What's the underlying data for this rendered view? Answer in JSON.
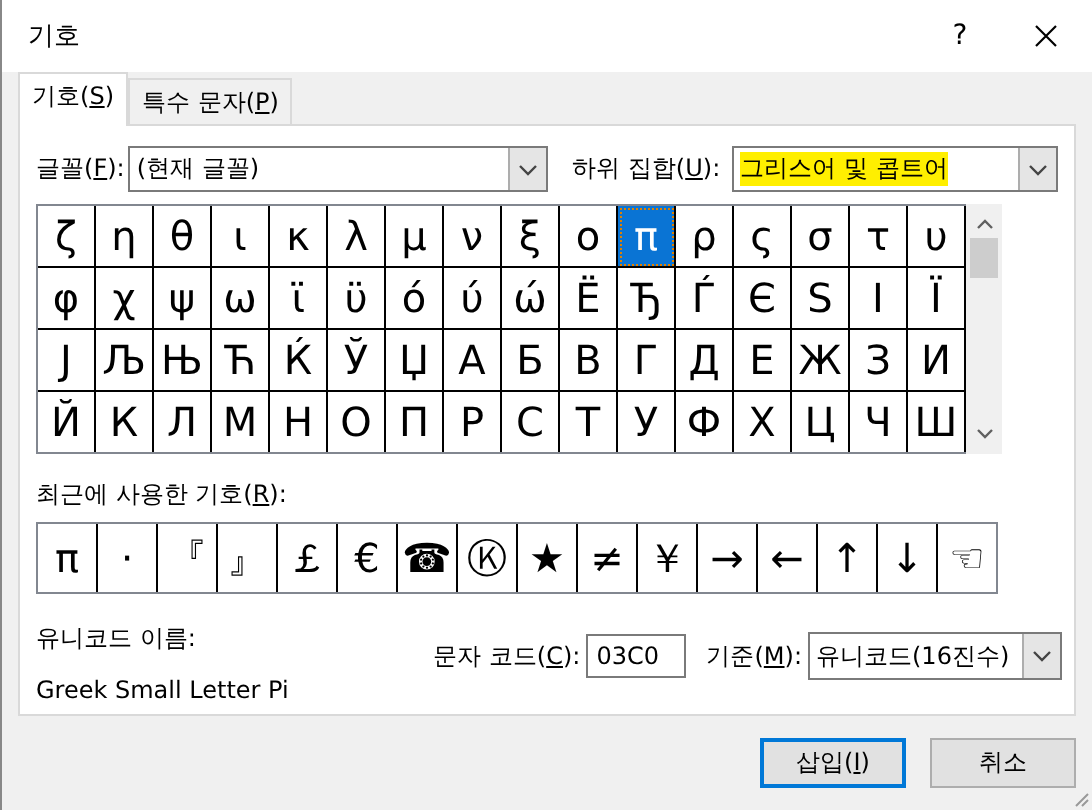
{
  "window": {
    "title": "기호",
    "help": "?"
  },
  "tabs": [
    {
      "label": {
        "pre": "기호(",
        "key": "S",
        "post": ")"
      },
      "selected": true
    },
    {
      "label": {
        "pre": "특수 문자(",
        "key": "P",
        "post": ")"
      },
      "selected": false
    }
  ],
  "font": {
    "label": {
      "pre": "글꼴(",
      "key": "F",
      "post": "):"
    },
    "value": "(현재 글꼴)"
  },
  "subset": {
    "label": {
      "pre": "하위 집합(",
      "key": "U",
      "post": "):"
    },
    "value": "그리스어 및 콥트어",
    "highlighted": true
  },
  "symbol_grid": [
    [
      {
        "char": "ζ",
        "selected": false
      },
      {
        "char": "η",
        "selected": false
      },
      {
        "char": "θ",
        "selected": false
      },
      {
        "char": "ι",
        "selected": false
      },
      {
        "char": "κ",
        "selected": false
      },
      {
        "char": "λ",
        "selected": false
      },
      {
        "char": "μ",
        "selected": false
      },
      {
        "char": "ν",
        "selected": false
      },
      {
        "char": "ξ",
        "selected": false
      },
      {
        "char": "ο",
        "selected": false
      },
      {
        "char": "π",
        "selected": true
      },
      {
        "char": "ρ",
        "selected": false
      },
      {
        "char": "ς",
        "selected": false
      },
      {
        "char": "σ",
        "selected": false
      },
      {
        "char": "τ",
        "selected": false
      },
      {
        "char": "υ",
        "selected": false
      }
    ],
    [
      {
        "char": "φ",
        "selected": false
      },
      {
        "char": "χ",
        "selected": false
      },
      {
        "char": "ψ",
        "selected": false
      },
      {
        "char": "ω",
        "selected": false
      },
      {
        "char": "ϊ",
        "selected": false
      },
      {
        "char": "ϋ",
        "selected": false
      },
      {
        "char": "ό",
        "selected": false
      },
      {
        "char": "ύ",
        "selected": false
      },
      {
        "char": "ώ",
        "selected": false
      },
      {
        "char": "Ё",
        "selected": false
      },
      {
        "char": "Ђ",
        "selected": false
      },
      {
        "char": "Ѓ",
        "selected": false
      },
      {
        "char": "Є",
        "selected": false
      },
      {
        "char": "Ѕ",
        "selected": false
      },
      {
        "char": "І",
        "selected": false
      },
      {
        "char": "Ї",
        "selected": false
      }
    ],
    [
      {
        "char": "Ј",
        "selected": false
      },
      {
        "char": "Љ",
        "selected": false
      },
      {
        "char": "Њ",
        "selected": false
      },
      {
        "char": "Ћ",
        "selected": false
      },
      {
        "char": "Ќ",
        "selected": false
      },
      {
        "char": "Ў",
        "selected": false
      },
      {
        "char": "Џ",
        "selected": false
      },
      {
        "char": "А",
        "selected": false
      },
      {
        "char": "Б",
        "selected": false
      },
      {
        "char": "В",
        "selected": false
      },
      {
        "char": "Г",
        "selected": false
      },
      {
        "char": "Д",
        "selected": false
      },
      {
        "char": "Е",
        "selected": false
      },
      {
        "char": "Ж",
        "selected": false
      },
      {
        "char": "З",
        "selected": false
      },
      {
        "char": "И",
        "selected": false
      }
    ],
    [
      {
        "char": "Й",
        "selected": false
      },
      {
        "char": "К",
        "selected": false
      },
      {
        "char": "Л",
        "selected": false
      },
      {
        "char": "М",
        "selected": false
      },
      {
        "char": "Н",
        "selected": false
      },
      {
        "char": "О",
        "selected": false
      },
      {
        "char": "П",
        "selected": false
      },
      {
        "char": "Р",
        "selected": false
      },
      {
        "char": "С",
        "selected": false
      },
      {
        "char": "Т",
        "selected": false
      },
      {
        "char": "У",
        "selected": false
      },
      {
        "char": "Ф",
        "selected": false
      },
      {
        "char": "Х",
        "selected": false
      },
      {
        "char": "Ц",
        "selected": false
      },
      {
        "char": "Ч",
        "selected": false
      },
      {
        "char": "Ш",
        "selected": false
      }
    ]
  ],
  "recent": {
    "label": {
      "pre": "최근에 사용한 기호(",
      "key": "R",
      "post": "):"
    },
    "symbols": [
      "π",
      "·",
      "『",
      "』",
      "￡",
      "€",
      "☎",
      "Ⓚ",
      "★",
      "≠",
      "￥",
      "→",
      "←",
      "↑",
      "↓",
      "☜"
    ]
  },
  "unicode_name": {
    "label": "유니코드 이름:",
    "value": "Greek Small Letter Pi"
  },
  "char_code": {
    "label": {
      "pre": "문자 코드(",
      "key": "C",
      "post": "):"
    },
    "value": "03C0"
  },
  "basis": {
    "label": {
      "pre": "기준(",
      "key": "M",
      "post": "):"
    },
    "value": "유니코드(16진수)"
  },
  "buttons": [
    {
      "label": {
        "pre": "삽입(",
        "key": "I",
        "post": ")"
      },
      "default": true
    },
    {
      "label": {
        "pre": "취소"
      },
      "default": false
    }
  ]
}
